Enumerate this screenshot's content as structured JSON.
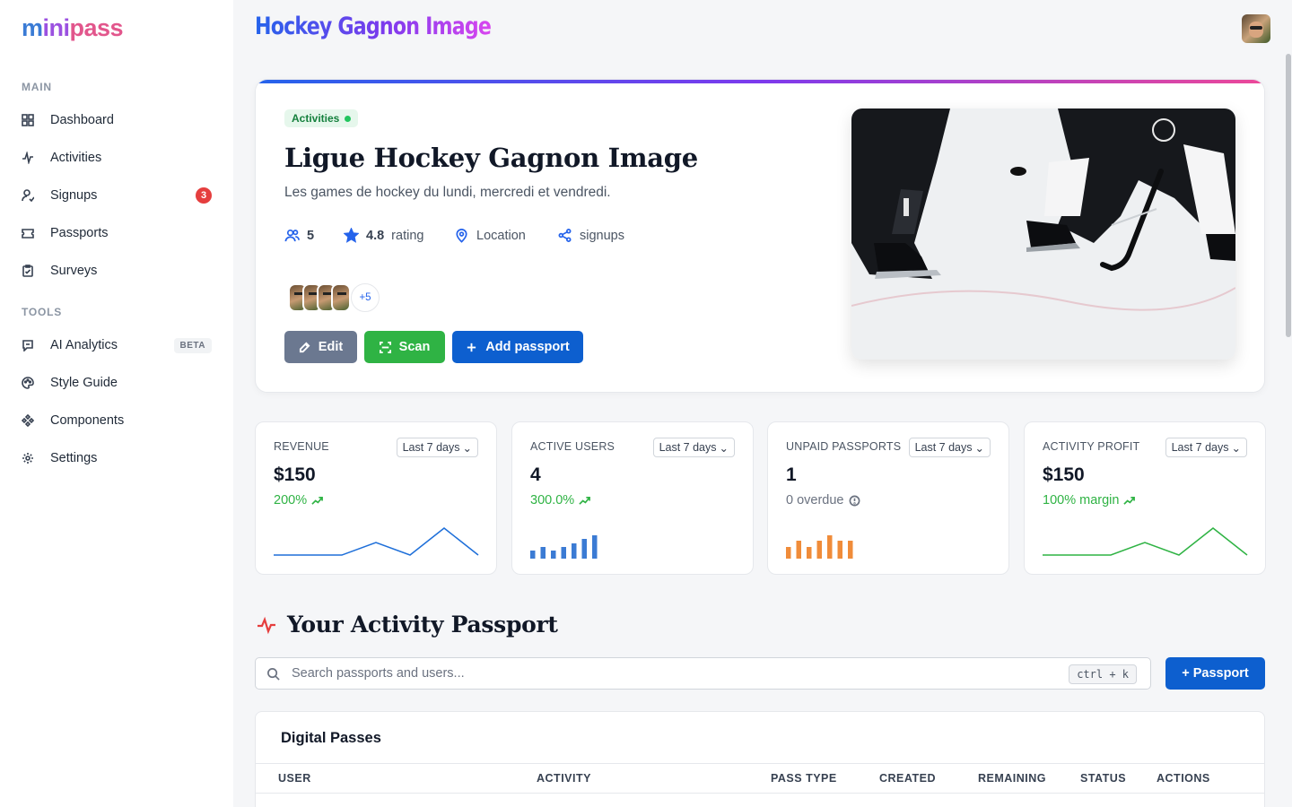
{
  "brand": {
    "logo_a": "m",
    "logo_b": "ini",
    "logo_c": "pass"
  },
  "sidebar": {
    "main_label": "MAIN",
    "tools_label": "TOOLS",
    "main_items": [
      {
        "label": "Dashboard",
        "icon": "dashboard-icon"
      },
      {
        "label": "Activities",
        "icon": "activity-pulse-icon"
      },
      {
        "label": "Signups",
        "icon": "user-signup-icon",
        "badge": "3"
      },
      {
        "label": "Passports",
        "icon": "ticket-icon"
      },
      {
        "label": "Surveys",
        "icon": "clipboard-icon"
      }
    ],
    "tools_items": [
      {
        "label": "AI Analytics",
        "icon": "message-icon",
        "badge": "BETA"
      },
      {
        "label": "Style Guide",
        "icon": "palette-icon"
      },
      {
        "label": "Components",
        "icon": "components-icon"
      },
      {
        "label": "Settings",
        "icon": "gear-icon"
      }
    ]
  },
  "header": {
    "title": "Hockey Gagnon Image"
  },
  "hero": {
    "pill": "Activities",
    "title": "Ligue Hockey Gagnon Image",
    "subtitle": "Les games de hockey du lundi, mercredi et vendredi.",
    "members": "5",
    "rating_value": "4.8",
    "rating_suffix": "rating",
    "location": "Location",
    "signups": "signups",
    "more_avatars": "+5",
    "edit_label": "Edit",
    "scan_label": "Scan",
    "add_passport_label": "Add passport"
  },
  "stats": [
    {
      "label": "REVENUE",
      "range": "Last 7 days",
      "value": "$150",
      "delta": "200%",
      "color": "#1e6fd9"
    },
    {
      "label": "ACTIVE USERS",
      "range": "Last 7 days",
      "value": "4",
      "delta": "300.0%",
      "color": "#3b7bd4",
      "bars": [
        2,
        3,
        2,
        3,
        4,
        5,
        6
      ]
    },
    {
      "label": "UNPAID PASSPORTS",
      "range": "Last 7 days",
      "value": "1",
      "delta": "0 overdue",
      "color": "#f08c3a",
      "bars": [
        2,
        3,
        2,
        3,
        4,
        3,
        3
      ]
    },
    {
      "label": "ACTIVITY PROFIT",
      "range": "Last 7 days",
      "value": "$150",
      "delta": "100% margin",
      "color": "#2fb344"
    }
  ],
  "section": {
    "title": "Your Activity Passport",
    "search_placeholder": "Search passports and users...",
    "shortcut": "ctrl + k",
    "add_label": "+ Passport"
  },
  "table": {
    "title": "Digital Passes",
    "columns": [
      "USER",
      "ACTIVITY",
      "PASS TYPE",
      "CREATED",
      "REMAINING",
      "STATUS",
      "ACTIONS"
    ]
  }
}
